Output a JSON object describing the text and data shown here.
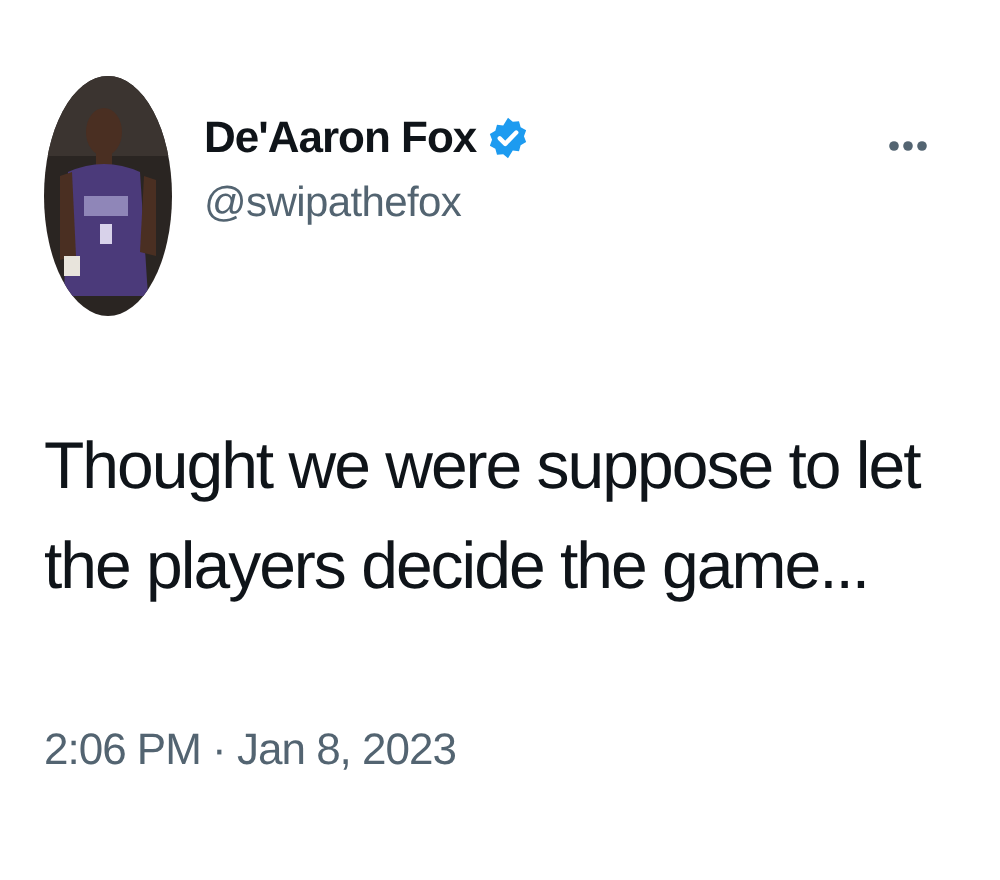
{
  "author": {
    "name": "De'Aaron Fox",
    "verified": true,
    "handle": "@swipathefox"
  },
  "tweet": {
    "text": "Thought we were suppose to let the players decide the game..."
  },
  "timestamp": "2:06 PM · Jan 8, 2023"
}
